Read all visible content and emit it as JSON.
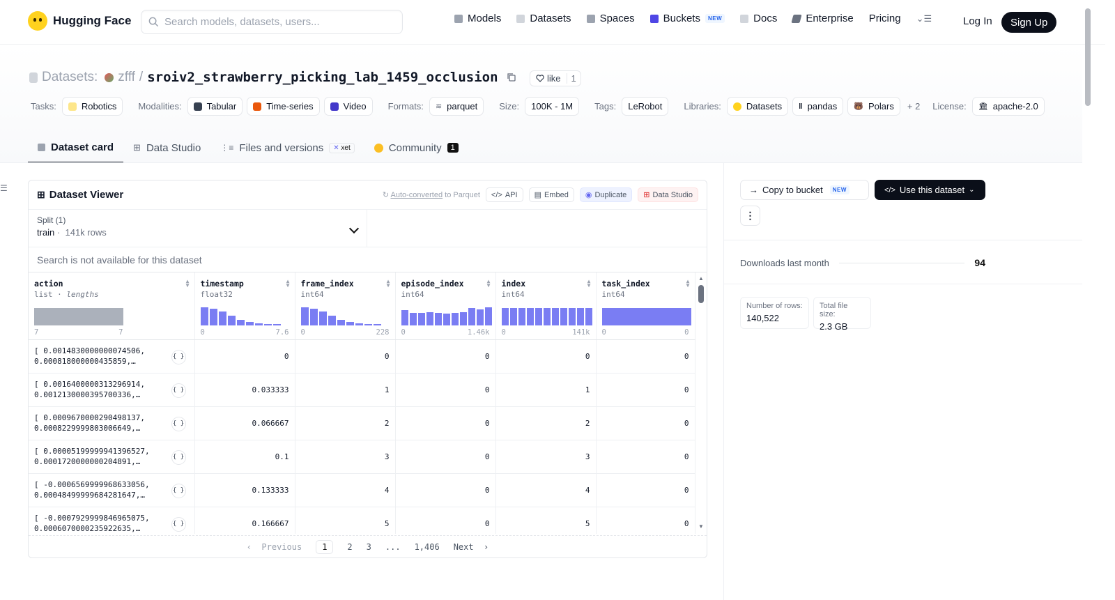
{
  "nav": {
    "logo_text": "Hugging Face",
    "search_placeholder": "Search models, datasets, users...",
    "links": [
      {
        "label": "Models",
        "icon": "models-icon",
        "color": "#9ca3af"
      },
      {
        "label": "Datasets",
        "icon": "datasets-icon",
        "color": "#d1d5db"
      },
      {
        "label": "Spaces",
        "icon": "spaces-icon",
        "color": "#9ca3af"
      },
      {
        "label": "Buckets",
        "icon": "buckets-icon",
        "color": "#4f46e5",
        "badge": "NEW"
      },
      {
        "label": "Docs",
        "icon": "docs-icon",
        "color": "#d1d5db"
      },
      {
        "label": "Enterprise",
        "icon": "enterprise-icon",
        "color": "#6b7280"
      },
      {
        "label": "Pricing"
      }
    ],
    "login": "Log In",
    "signup": "Sign Up"
  },
  "header": {
    "section": "Datasets:",
    "owner": "zfff",
    "separator": "/",
    "repo": "sroiv2_strawberry_picking_lab_1459_occlusion",
    "like_label": "like",
    "like_count": "1"
  },
  "tags": {
    "tasks_label": "Tasks:",
    "tasks": [
      "Robotics"
    ],
    "modalities_label": "Modalities:",
    "modalities": [
      "Tabular",
      "Time-series",
      "Video"
    ],
    "formats_label": "Formats:",
    "formats": [
      "parquet"
    ],
    "size_label": "Size:",
    "size": "100K - 1M",
    "tags_label": "Tags:",
    "tags": [
      "LeRobot"
    ],
    "libraries_label": "Libraries:",
    "libraries": [
      "Datasets",
      "pandas",
      "Polars"
    ],
    "more": "+ 2",
    "license_label": "License:",
    "license": "apache-2.0"
  },
  "tabs": {
    "card": "Dataset card",
    "studio": "Data Studio",
    "files": "Files and versions",
    "xet": "xet",
    "community": "Community",
    "community_count": "1"
  },
  "viewer": {
    "title": "Dataset Viewer",
    "auto": "Auto-converted",
    "auto_suffix": "to Parquet",
    "api": "API",
    "embed": "Embed",
    "duplicate": "Duplicate",
    "studio": "Data Studio",
    "split_label": "Split (1)",
    "split_value": "train",
    "split_rows": "141k rows",
    "search_na": "Search is not available for this dataset",
    "columns": [
      {
        "name": "action",
        "type": "list",
        "extra": "lengths",
        "min": "7",
        "max": "7"
      },
      {
        "name": "timestamp",
        "type": "float32",
        "min": "0",
        "max": "7.6"
      },
      {
        "name": "frame_index",
        "type": "int64",
        "min": "0",
        "max": "228"
      },
      {
        "name": "episode_index",
        "type": "int64",
        "min": "0",
        "max": "1.46k"
      },
      {
        "name": "index",
        "type": "int64",
        "min": "0",
        "max": "141k"
      },
      {
        "name": "task_index",
        "type": "int64",
        "min": "0",
        "max": "0"
      }
    ],
    "rows": [
      {
        "a1": "[ 0.0014830000000074506,",
        "a2": "0.000818000000435859,…",
        "ts": "0",
        "fi": "0",
        "ei": "0",
        "ix": "0",
        "ti": "0"
      },
      {
        "a1": "[ 0.0016400000313296914,",
        "a2": "0.0012130000395700336,…",
        "ts": "0.033333",
        "fi": "1",
        "ei": "0",
        "ix": "1",
        "ti": "0"
      },
      {
        "a1": "[ 0.0009670000290498137,",
        "a2": "0.0008229999803006649,…",
        "ts": "0.066667",
        "fi": "2",
        "ei": "0",
        "ix": "2",
        "ti": "0"
      },
      {
        "a1": "[ 0.00005199999941396527,",
        "a2": "0.0001720000000204891,…",
        "ts": "0.1",
        "fi": "3",
        "ei": "0",
        "ix": "3",
        "ti": "0"
      },
      {
        "a1": "[ -0.0006569999968633056,",
        "a2": "0.00048499999684281647,…",
        "ts": "0.133333",
        "fi": "4",
        "ei": "0",
        "ix": "4",
        "ti": "0"
      },
      {
        "a1": "[ -0.0007929999846965075,",
        "a2": "0.0006070000235922635,…",
        "ts": "0.166667",
        "fi": "5",
        "ei": "0",
        "ix": "5",
        "ti": "0"
      }
    ],
    "json_icon": "{ }",
    "pager": {
      "prev": "Previous",
      "pages": [
        "1",
        "2",
        "3",
        "...",
        "1,406"
      ],
      "next": "Next"
    }
  },
  "side": {
    "copy_bucket": "Copy to bucket",
    "new": "NEW",
    "use": "Use this dataset",
    "downloads_label": "Downloads last month",
    "downloads": "94",
    "rows_label": "Number of rows:",
    "rows": "140,522",
    "size_label": "Total file size:",
    "size": "2.3 GB"
  }
}
